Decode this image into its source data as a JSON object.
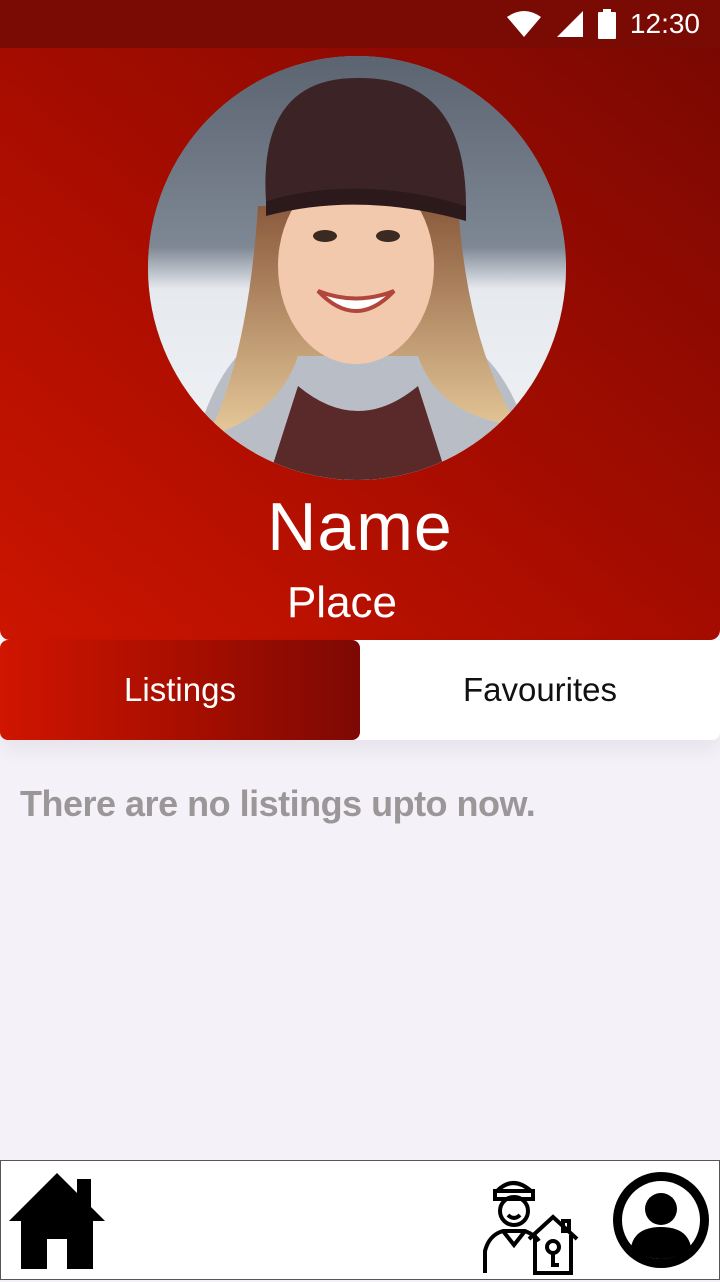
{
  "status_bar": {
    "time": "12:30",
    "icons": [
      "wifi-icon",
      "signal-icon",
      "battery-icon"
    ]
  },
  "profile": {
    "name": "Name",
    "place": "Place",
    "avatar_alt": "profile photo"
  },
  "tabs": [
    {
      "label": "Listings",
      "active": true
    },
    {
      "label": "Favourites",
      "active": false
    }
  ],
  "empty_state": {
    "message": "There are no listings upto now."
  },
  "bottom_nav": {
    "items": [
      "home-icon",
      "agent-house-icon",
      "profile-icon"
    ]
  },
  "colors": {
    "accent": "#a90d00",
    "status_bar": "#7a0a04",
    "background": "#f4f2f8",
    "muted_text": "#9b9698"
  }
}
